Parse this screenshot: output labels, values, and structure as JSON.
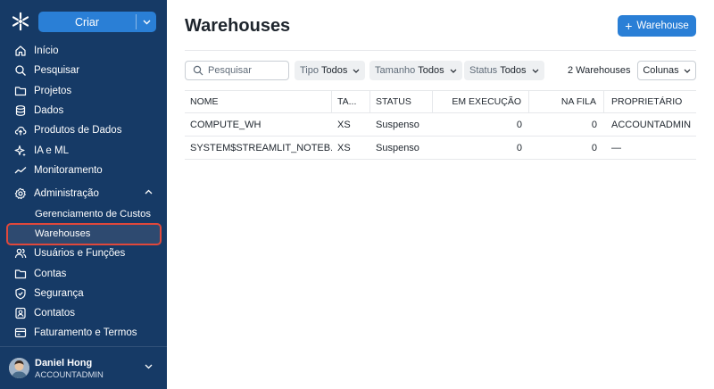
{
  "sidebar": {
    "create_label": "Criar",
    "items": [
      {
        "label": "Início",
        "icon": "home-icon"
      },
      {
        "label": "Pesquisar",
        "icon": "search-icon"
      },
      {
        "label": "Projetos",
        "icon": "folder-icon"
      },
      {
        "label": "Dados",
        "icon": "database-icon"
      },
      {
        "label": "Produtos de Dados",
        "icon": "cloud-upload-icon"
      },
      {
        "label": "IA e ML",
        "icon": "sparkle-icon"
      },
      {
        "label": "Monitoramento",
        "icon": "activity-icon"
      },
      {
        "label": "Administração",
        "icon": "gear-icon"
      }
    ],
    "admin_subitems": [
      {
        "label": "Gerenciamento de Custos"
      },
      {
        "label": "Warehouses"
      }
    ],
    "admin_items": [
      {
        "label": "Usuários e Funções",
        "icon": "users-icon"
      },
      {
        "label": "Contas",
        "icon": "folder-icon"
      },
      {
        "label": "Segurança",
        "icon": "shield-icon"
      },
      {
        "label": "Contatos",
        "icon": "contact-icon"
      },
      {
        "label": "Faturamento e Termos",
        "icon": "billing-icon"
      }
    ],
    "user": {
      "name": "Daniel Hong",
      "role": "ACCOUNTADMIN"
    }
  },
  "main": {
    "title": "Warehouses",
    "add_button_label": "Warehouse",
    "search_placeholder": "Pesquisar",
    "filters": [
      {
        "label": "Tipo",
        "value": "Todos"
      },
      {
        "label": "Tamanho",
        "value": "Todos"
      },
      {
        "label": "Status",
        "value": "Todos"
      }
    ],
    "count_label": "2 Warehouses",
    "columns_button_label": "Colunas",
    "table": {
      "headers": [
        "NOME",
        "TA...",
        "STATUS",
        "EM EXECUÇÃO",
        "NA FILA",
        "PROPRIETÁRIO"
      ],
      "rows": [
        [
          "COMPUTE_WH",
          "XS",
          "Suspenso",
          "0",
          "0",
          "ACCOUNTADMIN"
        ],
        [
          "SYSTEM$STREAMLIT_NOTEB...",
          "XS",
          "Suspenso",
          "0",
          "0",
          "—"
        ]
      ]
    }
  },
  "colors": {
    "sidebar_bg": "#163a66",
    "primary": "#2a7fd6",
    "highlight_border": "#e0483b"
  }
}
